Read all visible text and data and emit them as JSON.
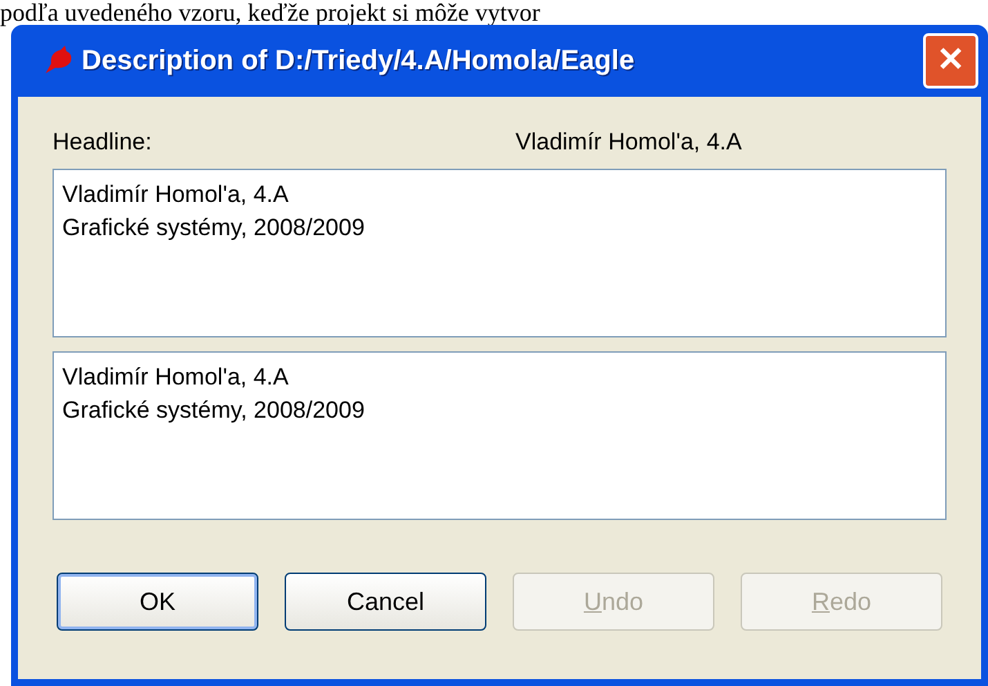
{
  "background_text": "podľa uvedeného vzoru, keďže projekt si môže vytvor",
  "window": {
    "title": "Description of D:/Triedy/4.A/Homola/Eagle",
    "close": "✕"
  },
  "headline": {
    "label": "Headline:",
    "value": "Vladimír Homol'a, 4.A"
  },
  "text_areas": [
    {
      "lines": [
        "Vladimír Homol'a, 4.A",
        "Grafické systémy, 2008/2009"
      ]
    },
    {
      "lines": [
        "Vladimír Homol'a, 4.A",
        "Grafické systémy, 2008/2009"
      ]
    }
  ],
  "buttons": [
    {
      "label": "OK",
      "disabled": false,
      "default": true,
      "mnemonic": false
    },
    {
      "label": "Cancel",
      "disabled": false,
      "default": false,
      "mnemonic": false
    },
    {
      "label": "Undo",
      "disabled": true,
      "default": false,
      "mnemonic": true
    },
    {
      "label": "Redo",
      "disabled": true,
      "default": false,
      "mnemonic": true
    }
  ]
}
